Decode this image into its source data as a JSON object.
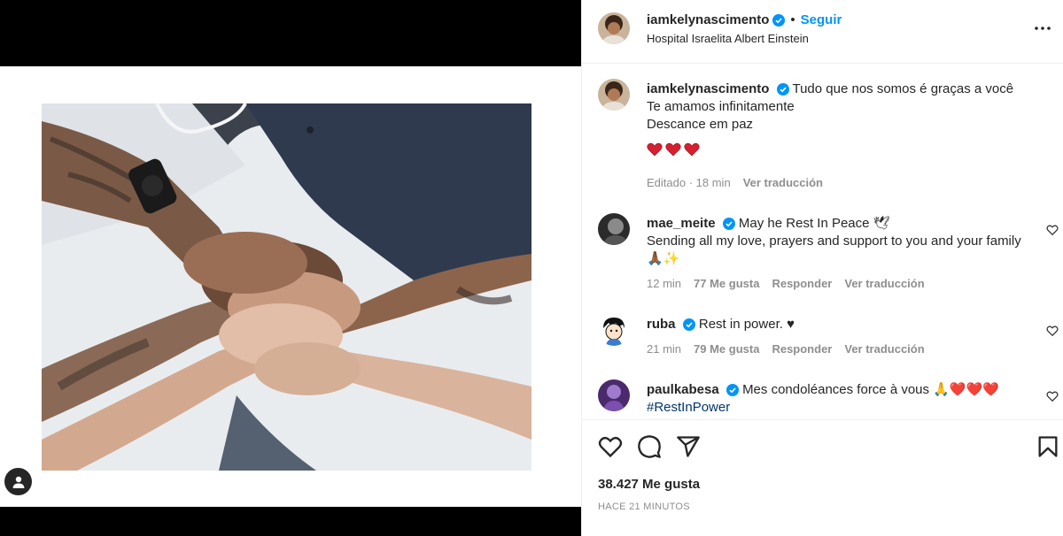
{
  "post": {
    "username": "iamkelynascimento",
    "follow_label": "Seguir",
    "location": "Hospital Israelita Albert Einstein",
    "caption_lines": [
      "Tudo que nos somos é graças a você",
      "Te amamos infinitamente",
      "Descance em paz"
    ],
    "caption_meta": {
      "edited": "Editado",
      "time": "18 min",
      "translate": "Ver traducción"
    },
    "likes": "38.427 Me gusta",
    "time_ago": "HACE 21 MINUTOS"
  },
  "comments": [
    {
      "username": "mae_meite",
      "text": "May he Rest In Peace 🕊",
      "text2": "Sending all my love, prayers and support to you and your family 🙏🏾✨",
      "time": "12 min",
      "likes": "77 Me gusta",
      "reply": "Responder",
      "translate": "Ver traducción"
    },
    {
      "username": "ruba",
      "text": "Rest in power. ♥",
      "time": "21 min",
      "likes": "79 Me gusta",
      "reply": "Responder",
      "translate": "Ver traducción"
    },
    {
      "username": "paulkabesa",
      "text": "Mes condoléances force à vous 🙏❤️❤️❤️",
      "hashtag": "#RestInPower"
    }
  ],
  "icons": {
    "more": "more-options-icon",
    "verified": "verified-badge-icon",
    "like": "heart-icon",
    "comment": "comment-icon",
    "share": "share-icon",
    "save": "bookmark-icon",
    "user_tag": "user-tag-icon"
  },
  "colors": {
    "accent": "#0095f6",
    "verified": "#0095f6",
    "heart": "#ed4956"
  }
}
